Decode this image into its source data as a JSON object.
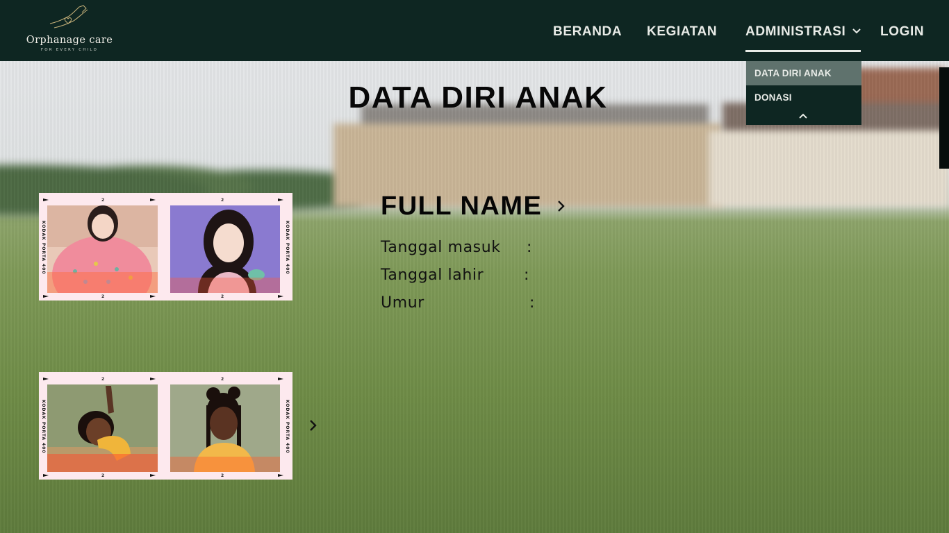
{
  "header": {
    "logo": {
      "brand": "Orphanage care",
      "tagline": "FOR EVERY CHILD",
      "icon": "hands-holding-heart-icon"
    },
    "nav": {
      "beranda": "BERANDA",
      "kegiatan": "KEGIATAN",
      "administrasi": "ADMINISTRASI",
      "login": "LOGIN"
    },
    "dropdown": [
      {
        "label": "DATA DIRI ANAK",
        "active": true
      },
      {
        "label": "DONASI",
        "active": false
      }
    ],
    "colors": {
      "bg": "#0e2622",
      "active_item": "#5f726d",
      "text": "#e8ebe7"
    }
  },
  "main": {
    "title": "DATA DIRI ANAK",
    "profile": {
      "name": "FULL NAME",
      "fields": [
        {
          "label": "Tanggal masuk",
          "separator": ":"
        },
        {
          "label": "Tanggal lahir",
          "separator": ":"
        },
        {
          "label": "Umur",
          "separator": ":"
        }
      ]
    },
    "film_strips": [
      {
        "brand": "KODAK  PORTA 400",
        "frame_number": "2"
      },
      {
        "brand": "KODAK  PORTA 400",
        "frame_number": "2"
      }
    ]
  }
}
